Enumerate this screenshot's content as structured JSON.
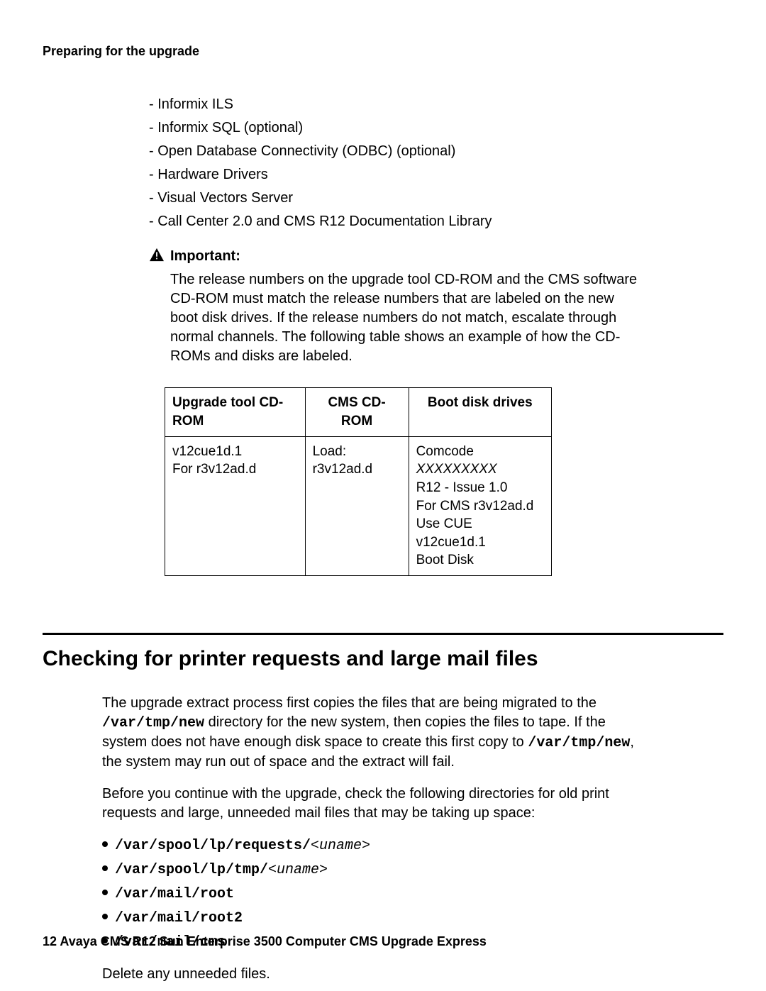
{
  "running_header": "Preparing for the upgrade",
  "dash_items": [
    "Informix ILS",
    "Informix SQL (optional)",
    "Open Database Connectivity (ODBC) (optional)",
    "Hardware Drivers",
    "Visual Vectors Server",
    "Call Center 2.0 and CMS R12 Documentation Library"
  ],
  "important": {
    "label": "Important:",
    "text": "The release numbers on the upgrade tool CD-ROM and the CMS software CD-ROM must match the release numbers that are labeled on the new boot disk drives. If the release numbers do not match, escalate through normal channels. The following table shows an example of how the CD-ROMs and disks are labeled."
  },
  "table": {
    "headers": [
      "Upgrade tool CD-ROM",
      "CMS CD-ROM",
      "Boot disk drives"
    ],
    "row": {
      "col1": "v12cue1d.1\nFor r3v12ad.d",
      "col2": "Load: r3v12ad.d",
      "col3_prefix": "Comcode ",
      "col3_italic": "XXXXXXXXX",
      "col3_rest": "\nR12 - Issue 1.0\nFor CMS r3v12ad.d\nUse CUE v12cue1d.1\nBoot Disk"
    }
  },
  "section_heading": "Checking for printer requests and large mail files",
  "para1": {
    "pre": "The upgrade extract process first copies the files that are being migrated to the ",
    "mono1": "/var/tmp/new",
    "mid": " directory for the new system, then copies the files to tape. If the system does not have enough disk space to create this first copy to ",
    "mono2": "/var/tmp/new",
    "post": ", the system may run out of space and the extract will fail."
  },
  "para2": "Before you continue with the upgrade, check the following directories for old print requests and large, unneeded mail files that may be taking up space:",
  "paths": [
    {
      "mono": "/var/spool/lp/requests/",
      "var": "<uname>"
    },
    {
      "mono": "/var/spool/lp/tmp/",
      "var": "<uname>"
    },
    {
      "mono": "/var/mail/root",
      "var": ""
    },
    {
      "mono": "/var/mail/root2",
      "var": ""
    },
    {
      "mono": "/var/mail/cms",
      "var": ""
    }
  ],
  "para3": "Delete any unneeded files.",
  "footer": {
    "page_num": "12",
    "sep": "   ",
    "title": "Avaya CMS R12 Sun Enterprise 3500 Computer CMS Upgrade Express"
  }
}
